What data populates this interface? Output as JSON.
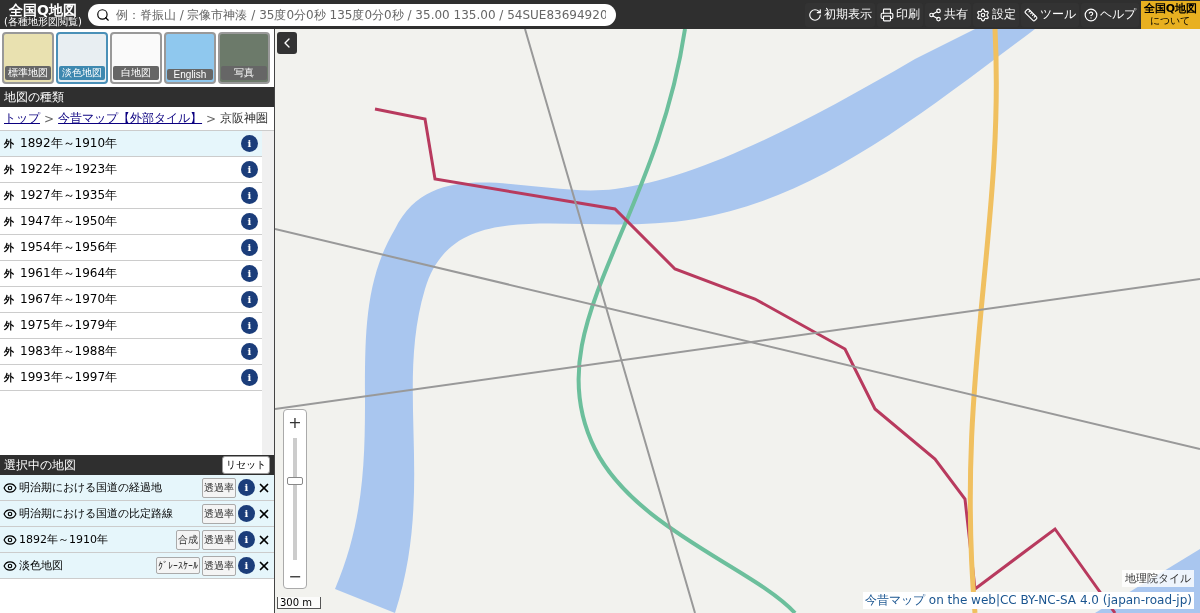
{
  "header": {
    "logo_title": "全国Q地図",
    "logo_subtitle": "(各種地形図閲覧)",
    "search": {
      "placeholder": "例：脊振山 / 宗像市神湊 / 35度0分0秒 135度0分0秒 / 35.00 135.00 / 54SUE83694920"
    },
    "tools": [
      {
        "kind": "reload",
        "label": "初期表示"
      },
      {
        "kind": "print",
        "label": "印刷"
      },
      {
        "kind": "share",
        "label": "共有"
      },
      {
        "kind": "settings",
        "label": "設定"
      },
      {
        "kind": "tool",
        "label": "ツール"
      },
      {
        "kind": "help",
        "label": "ヘルプ"
      }
    ],
    "about": {
      "title": "全国Q地図",
      "subtitle": "について"
    }
  },
  "basemaps": [
    {
      "label": "標準地図",
      "kind": "standard",
      "selected": false
    },
    {
      "label": "淡色地図",
      "kind": "pale",
      "selected": true
    },
    {
      "label": "白地図",
      "kind": "blank",
      "selected": false
    },
    {
      "label": "English",
      "kind": "english",
      "selected": false
    },
    {
      "label": "写真",
      "kind": "photo",
      "selected": false
    }
  ],
  "map_types": {
    "title": "地図の種類",
    "breadcrumb": [
      {
        "label": "トップ",
        "link": true
      },
      {
        "separator": ">",
        "label": "今昔マップ【外部タイル】",
        "link": true
      },
      {
        "separator": ">",
        "label": "京阪神圏",
        "link": false
      }
    ],
    "items": [
      {
        "badge": "外",
        "label": "1892年～1910年",
        "info": "i",
        "selected": true
      },
      {
        "badge": "外",
        "label": "1922年～1923年",
        "info": "i",
        "selected": false
      },
      {
        "badge": "外",
        "label": "1927年～1935年",
        "info": "i",
        "selected": false
      },
      {
        "badge": "外",
        "label": "1947年～1950年",
        "info": "i",
        "selected": false
      },
      {
        "badge": "外",
        "label": "1954年～1956年",
        "info": "i",
        "selected": false
      },
      {
        "badge": "外",
        "label": "1961年～1964年",
        "info": "i",
        "selected": false
      },
      {
        "badge": "外",
        "label": "1967年～1970年",
        "info": "i",
        "selected": false
      },
      {
        "badge": "外",
        "label": "1975年～1979年",
        "info": "i",
        "selected": false
      },
      {
        "badge": "外",
        "label": "1983年～1988年",
        "info": "i",
        "selected": false
      },
      {
        "badge": "外",
        "label": "1993年～1997年",
        "info": "i",
        "selected": false
      }
    ]
  },
  "selected_maps": {
    "title": "選択中の地図",
    "reset": "リセット",
    "items": [
      {
        "label": "明治期における国道の経過地",
        "buttons": [
          "透過率"
        ],
        "info": "i"
      },
      {
        "label": "明治期における国道の比定路線",
        "buttons": [
          "透過率"
        ],
        "info": "i"
      },
      {
        "label": "1892年～1910年",
        "buttons": [
          "合成",
          "透過率"
        ],
        "info": "i"
      },
      {
        "label": "淡色地図",
        "buttons": [
          "ｸﾞﾚｰｽｹｰﾙ",
          "透過率"
        ],
        "info": "i"
      }
    ]
  },
  "map": {
    "zoom_in": "+",
    "zoom_out": "−",
    "zoom": {
      "level": 0.65
    },
    "scale": "300 m",
    "tile_credit": "地理院タイル",
    "attribution": "今昔マップ on the web|CC BY-NC-SA 4.0 (japan-road-jp)"
  }
}
